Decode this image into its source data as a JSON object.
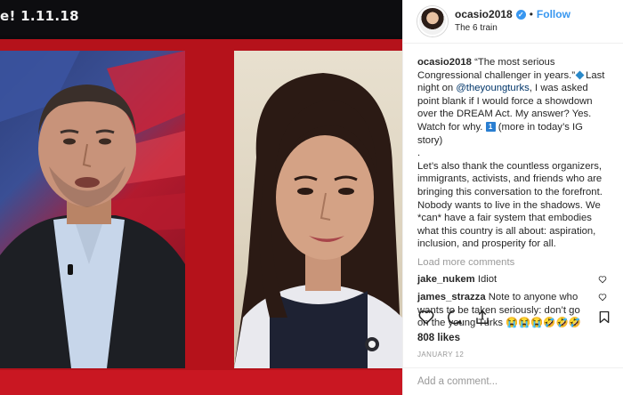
{
  "media": {
    "overlay_text": "e! 1.11.18"
  },
  "post": {
    "username": "ocasio2018",
    "verified_icon": "verified-badge-icon",
    "follow_label": "Follow",
    "location": "The 6 train",
    "caption": {
      "username": "ocasio2018",
      "part1": "“The most serious Congressional challenger in years.”",
      "part2": "Last night on ",
      "mention": "@theyoungturks",
      "part3": ", I was asked point blank if I would force a showdown over the DREAM Act. My answer? Yes. Watch for why. ",
      "icon_glyph": "1",
      "part4": " (more in today’s IG story)\n.\nLet’s also thank the countless organizers, immigrants, activists, and friends who are bringing this conversation to the forefront. Nobody wants to live in the shadows. We *can* have a fair system that embodies what this country is all about: aspiration, inclusion, and prosperity for all."
    },
    "load_more": "Load more comments",
    "comments": [
      {
        "username": "jake_nukem",
        "text": "Idiot"
      },
      {
        "username": "james_strazza",
        "text": "Note to anyone who wants to be taken seriously: don’t go on the young Turks 😭😭😭🤣🤣🤣"
      }
    ],
    "likes": "808 likes",
    "date": "JANUARY 12",
    "add_comment_placeholder": "Add a comment..."
  },
  "colors": {
    "accent": "#3897f0",
    "frame_red": "#b5121b",
    "muted": "#999999"
  }
}
